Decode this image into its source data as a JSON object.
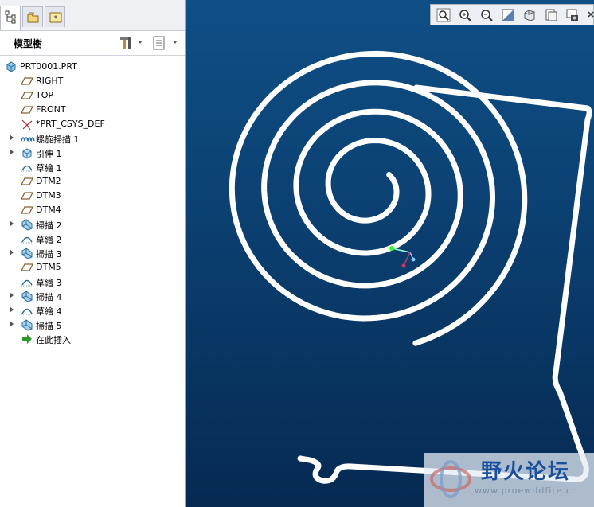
{
  "panel": {
    "title": "模型樹"
  },
  "tree": [
    {
      "label": "PRT0001.PRT",
      "icon": "part-icon",
      "expandable": false
    },
    {
      "label": "RIGHT",
      "icon": "datum-plane-icon",
      "expandable": false
    },
    {
      "label": "TOP",
      "icon": "datum-plane-icon",
      "expandable": false
    },
    {
      "label": "FRONT",
      "icon": "datum-plane-icon",
      "expandable": false
    },
    {
      "label": "*PRT_CSYS_DEF",
      "icon": "coordinate-system-icon",
      "expandable": false
    },
    {
      "label": "螺旋掃描 1",
      "icon": "helical-sweep-icon",
      "expandable": true
    },
    {
      "label": "引伸 1",
      "icon": "extrude-icon",
      "expandable": true
    },
    {
      "label": "草繪 1",
      "icon": "sketch-icon",
      "expandable": false
    },
    {
      "label": "DTM2",
      "icon": "datum-plane-icon",
      "expandable": false
    },
    {
      "label": "DTM3",
      "icon": "datum-plane-icon",
      "expandable": false
    },
    {
      "label": "DTM4",
      "icon": "datum-plane-icon",
      "expandable": false
    },
    {
      "label": "掃描 2",
      "icon": "sweep-icon",
      "expandable": true
    },
    {
      "label": "草繪 2",
      "icon": "sketch-icon",
      "expandable": false
    },
    {
      "label": "掃描 3",
      "icon": "sweep-icon",
      "expandable": true
    },
    {
      "label": "DTM5",
      "icon": "datum-plane-icon",
      "expandable": false
    },
    {
      "label": "草繪 3",
      "icon": "sketch-icon",
      "expandable": false
    },
    {
      "label": "掃描 4",
      "icon": "sweep-icon",
      "expandable": true
    },
    {
      "label": "草繪 4",
      "icon": "sketch-icon",
      "expandable": true
    },
    {
      "label": "掃描 5",
      "icon": "sweep-icon",
      "expandable": true
    },
    {
      "label": "在此插入",
      "icon": "insert-here-arrow-icon",
      "expandable": false
    }
  ],
  "view_toolbar": [
    "zoom-fit-icon",
    "zoom-in-icon",
    "zoom-out-icon",
    "repaint-icon",
    "shading-icon",
    "saved-views-icon",
    "layers-icon",
    "close-icon"
  ],
  "watermark": {
    "title": "野火论坛",
    "url": "www.proewildfire.cn"
  },
  "colors": {
    "viewport_top": "#0f4f86",
    "viewport_bottom": "#062a52",
    "wire": "#ffffff"
  }
}
